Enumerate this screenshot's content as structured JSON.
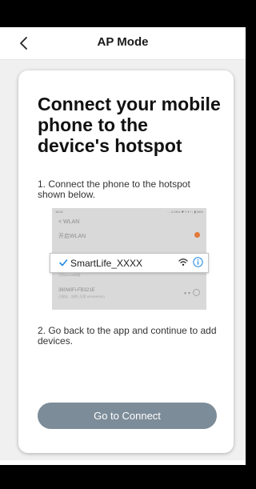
{
  "nav": {
    "title": "AP Mode"
  },
  "card": {
    "title": "Connect your mobile phone to the device's hotspot",
    "step1": "1. Connect the phone to the hotspot shown below.",
    "step2": "2. Go back to the app and continue to add devices."
  },
  "hotspot_preview": {
    "status_time": "16:41",
    "status_icons": "… 0.2K/s ✱ ≡ ▾ ↑↓ ▮ 58%",
    "header": "< WLAN",
    "wlan_label": "开启WLAN",
    "faded_row_1": "已连接设备名称",
    "faded_row_2": "可用WLAN网络",
    "network_2_name": "360WiFi-FB321E",
    "network_2_sub": "已保存，加密 (可用 WPA/WPA2)",
    "network_2_icons": "● ▾"
  },
  "selected_network": {
    "ssid": "SmartLife_XXXX",
    "check_icon": "check-icon",
    "wifi_icon": "wifi-icon",
    "info_icon": "info-icon"
  },
  "actions": {
    "connect_label": "Go to Connect"
  },
  "colors": {
    "button": "#7c8c99",
    "accent_blue": "#1e88e5",
    "toggle_orange": "#e0793a"
  }
}
